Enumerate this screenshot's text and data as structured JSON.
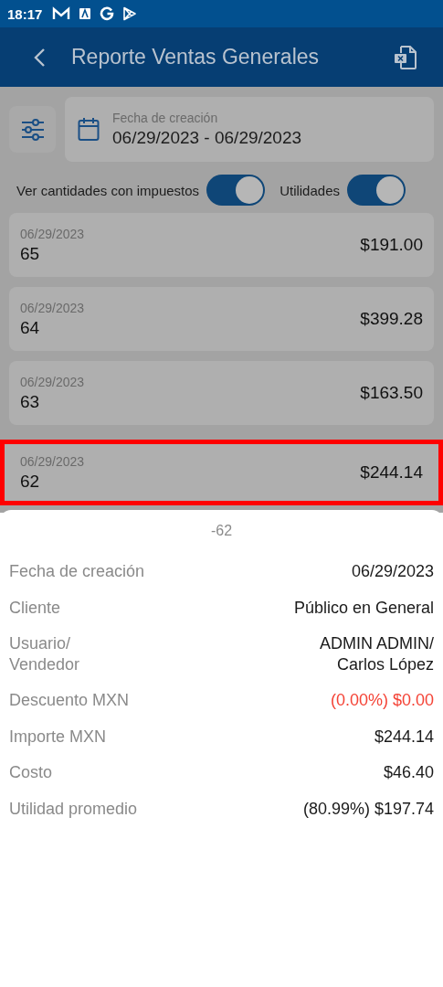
{
  "status_bar": {
    "time": "18:17"
  },
  "header": {
    "title": "Reporte Ventas Generales"
  },
  "date_filter": {
    "label": "Fecha de creación",
    "value": "06/29/2023 - 06/29/2023"
  },
  "toggles": [
    {
      "label": "Ver cantidades con impuestos",
      "on": true
    },
    {
      "label": "Utilidades",
      "on": true
    }
  ],
  "sales": [
    {
      "date": "06/29/2023",
      "number": "65",
      "amount": "$191.00",
      "highlighted": false
    },
    {
      "date": "06/29/2023",
      "number": "64",
      "amount": "$399.28",
      "highlighted": false
    },
    {
      "date": "06/29/2023",
      "number": "63",
      "amount": "$163.50",
      "highlighted": false
    },
    {
      "date": "06/29/2023",
      "number": "62",
      "amount": "$244.14",
      "highlighted": true
    }
  ],
  "detail_sheet": {
    "title": "-62",
    "rows": [
      {
        "label": "Fecha de creación",
        "value": "06/29/2023",
        "alert": false
      },
      {
        "label": "Cliente",
        "value": "Público en General",
        "alert": false
      },
      {
        "label": "Usuario/\nVendedor",
        "value": "ADMIN ADMIN/\nCarlos López",
        "alert": false
      },
      {
        "label": "Descuento MXN",
        "value": "(0.00%) $0.00",
        "alert": true
      },
      {
        "label": "Importe MXN",
        "value": "$244.14",
        "alert": false
      },
      {
        "label": "Costo",
        "value": "$46.40",
        "alert": false
      },
      {
        "label": "Utilidad promedio",
        "value": "(80.99%) $197.74",
        "alert": false
      }
    ]
  }
}
